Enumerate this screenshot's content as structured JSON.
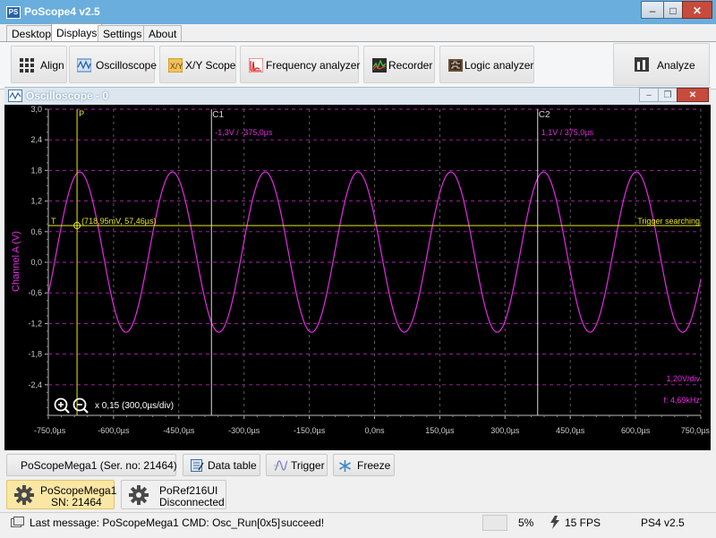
{
  "window": {
    "title": "PoScope4 v2.5",
    "minimize": "–",
    "maximize": "□",
    "close": "✕"
  },
  "menu_tabs": [
    {
      "label": "Desktop"
    },
    {
      "label": "Displays"
    },
    {
      "label": "Settings"
    },
    {
      "label": "About"
    }
  ],
  "ribbon": {
    "align": "Align",
    "oscilloscope": "Oscilloscope",
    "xy_scope": "X/Y Scope",
    "frequency_analyzer": "Frequency analyzer",
    "recorder": "Recorder",
    "logic_analyzer": "Logic analyzer",
    "analyze": "Analyze"
  },
  "child_window": {
    "title": "Oscilloscope - 0",
    "minimize": "–",
    "restore": "❐",
    "close": "✕"
  },
  "scope": {
    "y_axis_label": "Channel A (V)",
    "cursor_p_label": "P",
    "cursor_c1_label": "C1",
    "cursor_c2_label": "C2",
    "c1_readout": "-1,3V / -375,0µs",
    "c2_readout": "1,1V / 375,0µs",
    "trigger_marker": "T",
    "trigger_point_readout": "(718,95mV, 57,46µs)",
    "trigger_status": "Trigger searching",
    "volts_per_div": "1,20V/div",
    "frequency": "f: 4,69kHz",
    "zoom_readout": "x 0,15 (300,0µs/div)",
    "colors": {
      "signal": "#e52ae5",
      "cursor_yellow": "#f0f020",
      "cursor_white": "#dddddd",
      "background": "#000000"
    }
  },
  "chart_data": {
    "type": "line",
    "ylabel": "Channel A (V)",
    "xlim": [
      -750,
      750
    ],
    "ylim": [
      -3.0,
      3.0
    ],
    "x_unit": "µs",
    "y_tick_labels": [
      "3,0",
      "2,4",
      "1,8",
      "1,2",
      "0,6",
      "0,0",
      "-0,6",
      "-1,2",
      "-1,8",
      "-2,4"
    ],
    "x_tick_labels": [
      "-750,0µs",
      "-600,0µs",
      "-450,0µs",
      "-300,0µs",
      "-150,0µs",
      "0,0ns",
      "150,0µs",
      "300,0µs",
      "450,0µs",
      "600,0µs",
      "750,0µs"
    ],
    "x_ticks": [
      -750,
      -600,
      -450,
      -300,
      -150,
      0,
      150,
      300,
      450,
      600,
      750
    ],
    "y_ticks": [
      3.0,
      2.4,
      1.8,
      1.2,
      0.6,
      0.0,
      -0.6,
      -1.2,
      -1.8,
      -2.4
    ],
    "signal": {
      "offset": 0.2,
      "amplitude": 1.57,
      "period": 213.3,
      "peak_time": -678
    },
    "trigger_level": 0.72,
    "cursor_p_time": -684,
    "cursor_c1_time": -375,
    "cursor_c2_time": 375,
    "trigger_point": {
      "x": -684,
      "y": 0.72
    },
    "grid": true
  },
  "bottom_controls": {
    "device": "PoScopeMega1 (Ser. no: 21464)",
    "data_table": "Data table",
    "trigger": "Trigger",
    "freeze": "Freeze"
  },
  "devices": [
    {
      "line1": "PoScopeMega1",
      "line2": "SN: 21464"
    },
    {
      "line1": "PoRef216UI",
      "line2": "Disconnected"
    }
  ],
  "status": {
    "last_message": "Last message: PoScopeMega1 CMD: Osc_Run[0x5]",
    "result": "succeed!",
    "cpu": "5%",
    "fps": "15 FPS",
    "version": "PS4 v2.5"
  }
}
